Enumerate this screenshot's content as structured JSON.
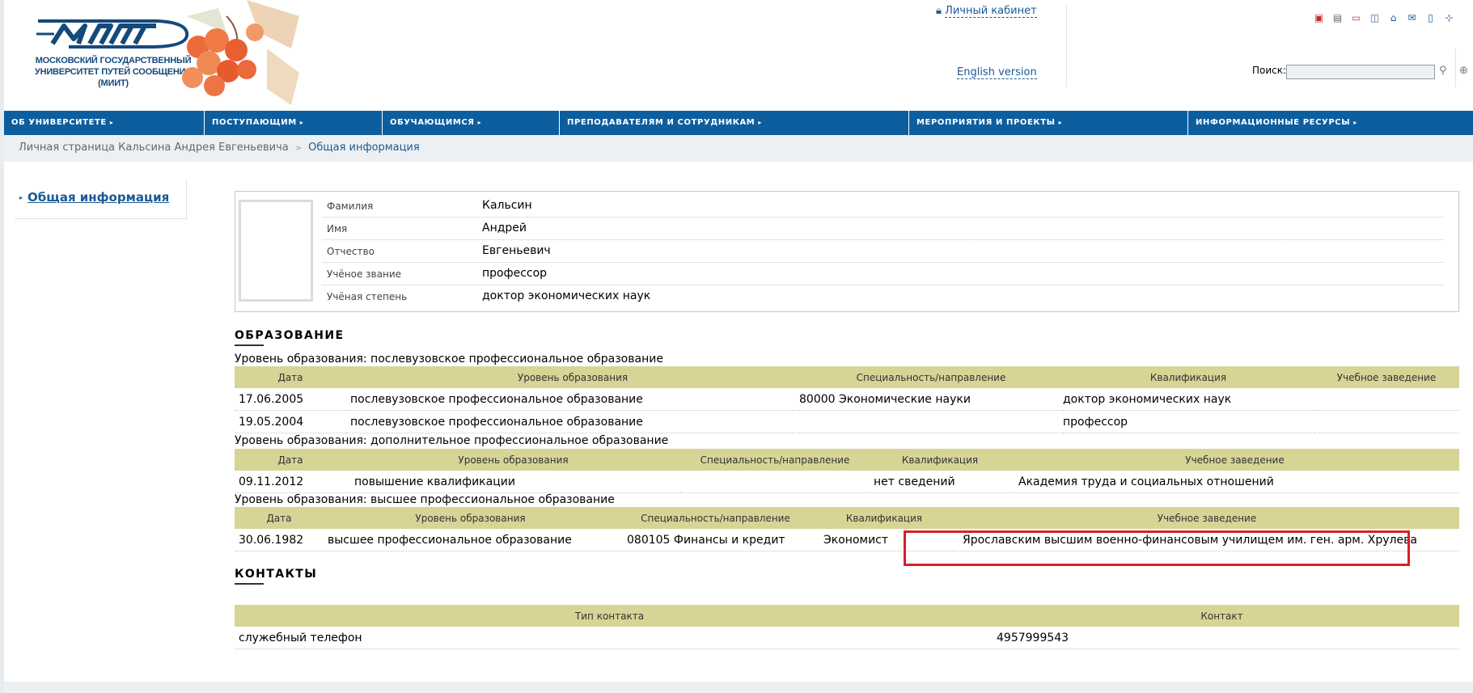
{
  "header": {
    "logo_name": "МИИТ",
    "logo_text": "МОСКОВСКИЙ ГОСУДАРСТВЕННЫЙ УНИВЕРСИТЕТ ПУТЕЙ СООБЩЕНИЯ (МИИТ)",
    "cabinet_label": "Личный кабинет",
    "english_label": "English version",
    "search_label": "Поиск:",
    "search_value": "",
    "icons": [
      "pdf-icon",
      "print-icon",
      "card-icon",
      "presentation-icon",
      "home-icon",
      "mail-icon",
      "mobile-icon",
      "sitemap-icon"
    ]
  },
  "nav": [
    {
      "label": "ОБ УНИВЕРСИТЕТЕ"
    },
    {
      "label": "ПОСТУПАЮЩИМ"
    },
    {
      "label": "ОБУЧАЮЩИМСЯ"
    },
    {
      "label": "ПРЕПОДАВАТЕЛЯМ И СОТРУДНИКАМ"
    },
    {
      "label": "МЕРОПРИЯТИЯ И ПРОЕКТЫ"
    },
    {
      "label": "ИНФОРМАЦИОННЫЕ РЕСУРСЫ"
    }
  ],
  "breadcrumb": {
    "parent": "Личная страница Кальсина Андрея Евгеньевича",
    "current": "Общая информация"
  },
  "left_menu": {
    "item": "Общая информация"
  },
  "profile": [
    {
      "label": "Фамилия",
      "value": "Кальсин"
    },
    {
      "label": "Имя",
      "value": "Андрей"
    },
    {
      "label": "Отчество",
      "value": "Евгеньевич"
    },
    {
      "label": "Учёное звание",
      "value": "профессор"
    },
    {
      "label": "Учёная степень",
      "value": "доктор экономических наук"
    }
  ],
  "education": {
    "title": "ОБРАЗОВАНИЕ",
    "groups": [
      {
        "level": "Уровень образования: послевузовское профессиональное образование",
        "headers": [
          "Дата",
          "Уровень образования",
          "Специальность/направление",
          "Квалификация",
          "Учебное заведение"
        ],
        "rows": [
          [
            "17.06.2005",
            "послевузовское профессиональное образование",
            "80000 Экономические науки",
            "доктор экономических наук",
            ""
          ],
          [
            "19.05.2004",
            "послевузовское профессиональное образование",
            "",
            "профессор",
            ""
          ]
        ]
      },
      {
        "level": "Уровень образования: дополнительное профессиональное образование",
        "headers": [
          "Дата",
          "Уровень образования",
          "Специальность/направление",
          "Квалификация",
          "Учебное заведение"
        ],
        "rows": [
          [
            "09.11.2012",
            "повышение квалификации",
            "",
            "нет сведений",
            "Академия труда и социальных отношений"
          ]
        ]
      },
      {
        "level": "Уровень образования: высшее профессиональное образование",
        "headers": [
          "Дата",
          "Уровень образования",
          "Специальность/направление",
          "Квалификация",
          "Учебное заведение"
        ],
        "rows": [
          [
            "30.06.1982",
            "высшее профессиональное образование",
            "080105 Финансы и кредит",
            "Экономист",
            "Ярославским высшим военно-финансовым училищем им. ген. арм. Хрулева"
          ]
        ]
      }
    ]
  },
  "contacts": {
    "title": "КОНТАКТЫ",
    "headers": [
      "Тип контакта",
      "Контакт"
    ],
    "rows": [
      [
        "служебный телефон",
        "4957999543"
      ]
    ]
  },
  "colors": {
    "nav": "#0d5e9f",
    "table_header": "#d7d496",
    "link": "#1a5a94",
    "highlight": "#d81f2a"
  }
}
